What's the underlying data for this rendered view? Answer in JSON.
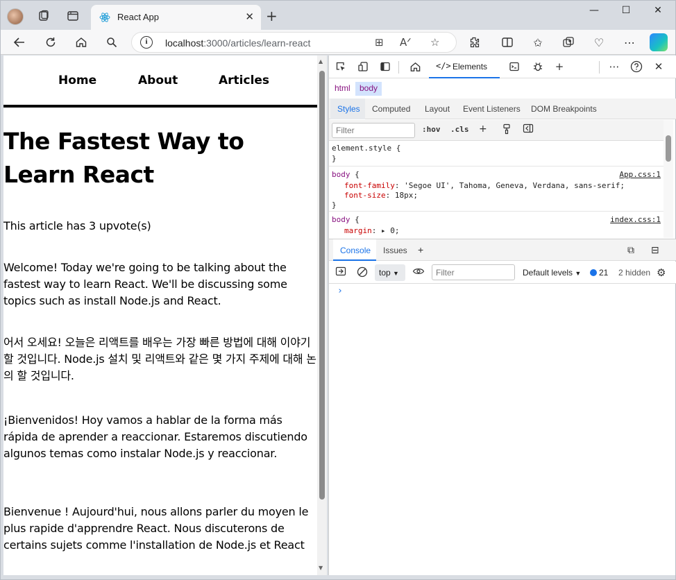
{
  "browser": {
    "tab_title": "React App",
    "address": {
      "host": "localhost",
      "path": ":3000/articles/learn-react"
    },
    "window_controls": {
      "minimize": "—",
      "maximize": "☐",
      "close": "✕"
    }
  },
  "page": {
    "nav": {
      "home": "Home",
      "about": "About",
      "articles": "Articles"
    },
    "title": "The Fastest Way to Learn React",
    "upvotes": "This article has 3 upvote(s)",
    "paragraphs": [
      "Welcome! Today we're going to be talking about the fastest way to learn React. We'll be discussing some topics such as install Node.js and React.",
      "어서 오세요! 오늘은 리액트를 배우는 가장 빠른 방법에 대해 이야기 할 것입니다. Node.js 설치 및 리액트와 같은 몇 가지 주제에 대해 논의 할 것입니다.",
      "¡Bienvenidos! Hoy vamos a hablar de la forma más rápida de aprender a reaccionar. Estaremos discutiendo algunos temas como instalar Node.js y reaccionar.",
      "Bienvenue ! Aujourd'hui, nous allons parler du moyen le plus rapide d'apprendre React. Nous discuterons de certains sujets comme l'installation de Node.js et React"
    ]
  },
  "devtools": {
    "elements_tab": "Elements",
    "elements_code": "</>",
    "breadcrumbs": [
      "html",
      "body"
    ],
    "subtabs": [
      "Styles",
      "Computed",
      "Layout",
      "Event Listeners",
      "DOM Breakpoints"
    ],
    "filter_placeholder": "Filter",
    "hov": ":hov",
    "cls": ".cls",
    "rules": {
      "element_style_open": "element.style {",
      "close": "}",
      "body_sel": "body",
      "open_brace": " {",
      "app_src": "App.css:1",
      "font_family_prop": "font-family",
      "font_family_val": ": 'Segoe UI', Tahoma, Geneva, Verdana, sans-serif;",
      "font_size_prop": "font-size",
      "font_size_val": ": 18px;",
      "index_src": "index.css:1",
      "margin_prop": "margin",
      "margin_val": ": ▸ 0;"
    },
    "console": {
      "tabs": [
        "Console",
        "Issues"
      ],
      "context": "top",
      "filter_placeholder": "Filter",
      "levels": "Default levels",
      "issues_count": "21",
      "hidden": "2 hidden",
      "prompt": "›"
    }
  },
  "colors": {
    "accent": "#1a73e8",
    "selector": "#881280",
    "property": "#c80000"
  }
}
